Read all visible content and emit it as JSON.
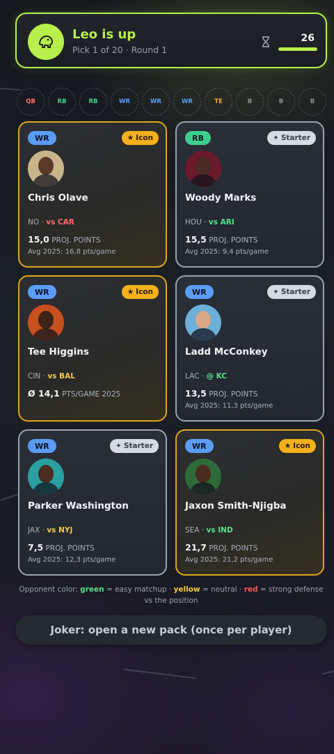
{
  "header": {
    "title": "Leo is up",
    "subtitle": "Pick 1 of 20 · Round 1",
    "timer": "26",
    "timer_progress": 1.0,
    "accent": "#b9ef4c"
  },
  "slots": [
    {
      "label": "QB",
      "color": "#ff6b6b"
    },
    {
      "label": "RB",
      "color": "#3ecf8e"
    },
    {
      "label": "RB",
      "color": "#3ecf8e"
    },
    {
      "label": "WR",
      "color": "#5b9cf5"
    },
    {
      "label": "WR",
      "color": "#5b9cf5"
    },
    {
      "label": "WR",
      "color": "#5b9cf5"
    },
    {
      "label": "TE",
      "color": "#f2a93b"
    },
    {
      "label": "B",
      "color": "#8a919c"
    },
    {
      "label": "B",
      "color": "#8a919c"
    },
    {
      "label": "B",
      "color": "#8a919c"
    }
  ],
  "cards": [
    {
      "pos": "WR",
      "pos_color": "#5b9cf5",
      "tier": "Icon",
      "tier_type": "icon",
      "name": "Chris Olave",
      "team": "NO",
      "opp": "vs CAR",
      "opp_color": "#ff6b6b",
      "proj": "15,0",
      "proj_label": "PROJ. POINTS",
      "avg": "Avg 2025: 16,8 pts/game",
      "photo_bg": "#c9b58a",
      "skin": "#5a3a2a"
    },
    {
      "pos": "RB",
      "pos_color": "#3ecf8e",
      "tier": "Starter",
      "tier_type": "starter",
      "name": "Woody Marks",
      "team": "HOU",
      "opp": "vs ARI",
      "opp_color": "#58e08a",
      "proj": "15,5",
      "proj_label": "PROJ. POINTS",
      "avg": "Avg 2025: 9,4 pts/game",
      "photo_bg": "#6a1a2a",
      "skin": "#4a2a22"
    },
    {
      "pos": "WR",
      "pos_color": "#5b9cf5",
      "tier": "Icon",
      "tier_type": "icon",
      "name": "Tee Higgins",
      "team": "CIN",
      "opp": "vs BAL",
      "opp_color": "#f2c94c",
      "proj": "Ø 14,1",
      "proj_label": "PTS/GAME 2025",
      "avg": "",
      "photo_bg": "#c8501e",
      "skin": "#3e2418"
    },
    {
      "pos": "WR",
      "pos_color": "#5b9cf5",
      "tier": "Starter",
      "tier_type": "starter",
      "name": "Ladd McConkey",
      "team": "LAC",
      "opp": "@ KC",
      "opp_color": "#58e08a",
      "proj": "13,5",
      "proj_label": "PROJ. POINTS",
      "avg": "Avg 2025: 11,3 pts/game",
      "photo_bg": "#6ab0d8",
      "skin": "#d8a887"
    },
    {
      "pos": "WR",
      "pos_color": "#5b9cf5",
      "tier": "Starter",
      "tier_type": "starter",
      "name": "Parker Washington",
      "team": "JAX",
      "opp": "vs NYJ",
      "opp_color": "#f2c94c",
      "proj": "7,5",
      "proj_label": "PROJ. POINTS",
      "avg": "Avg 2025: 12,3 pts/game",
      "photo_bg": "#2aa0a0",
      "skin": "#4a2c20"
    },
    {
      "pos": "WR",
      "pos_color": "#5b9cf5",
      "tier": "Icon",
      "tier_type": "icon",
      "name": "Jaxon Smith-Njigba",
      "team": "SEA",
      "opp": "vs IND",
      "opp_color": "#58e08a",
      "proj": "21,7",
      "proj_label": "PROJ. POINTS",
      "avg": "Avg 2025: 21,2 pts/game",
      "photo_bg": "#2e6a3a",
      "skin": "#4a2c20"
    }
  ],
  "legend": {
    "prefix": "Opponent color:",
    "green": "green",
    "green_text": "= easy matchup ·",
    "yellow": "yellow",
    "yellow_text": "= neutral ·",
    "red": "red",
    "red_text": "= strong defense vs the position"
  },
  "joker_label": "Joker: open a new pack (once per player)"
}
